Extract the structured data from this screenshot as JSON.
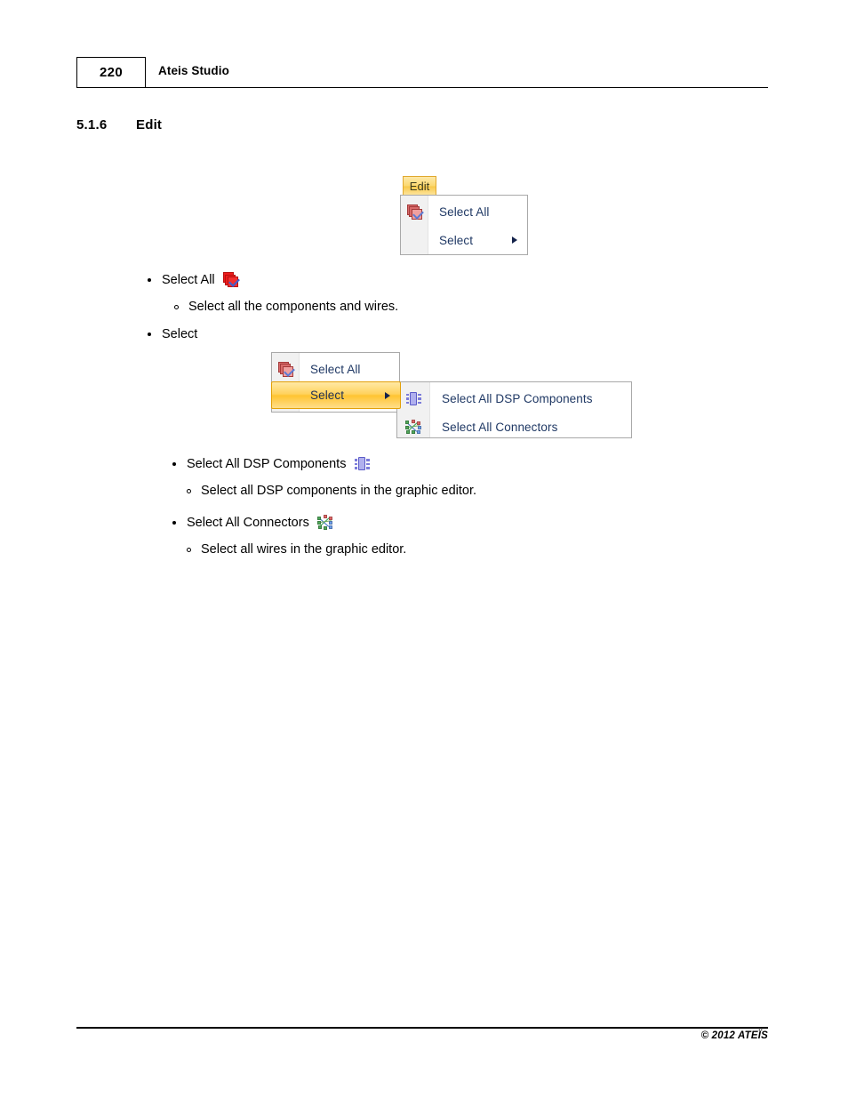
{
  "header": {
    "page_number": "220",
    "title": "Ateis Studio"
  },
  "section": {
    "number": "5.1.6",
    "title": "Edit"
  },
  "figure_edit_menu": {
    "tab_label": "Edit",
    "items": [
      {
        "label": "Select All",
        "icon": "select-all-icon",
        "has_submenu": false
      },
      {
        "label": "Select",
        "icon": "",
        "has_submenu": true
      }
    ]
  },
  "figure_select_menu": {
    "items": [
      {
        "label": "Select All",
        "icon": "select-all-icon",
        "has_submenu": false
      },
      {
        "label": "Select",
        "icon": "",
        "has_submenu": true,
        "highlighted": true
      }
    ],
    "submenu": {
      "items": [
        {
          "label": "Select All DSP Components",
          "icon": "dsp-components-icon"
        },
        {
          "label": "Select All Connectors",
          "icon": "connectors-icon"
        }
      ]
    }
  },
  "body": {
    "bullet_select_all": "Select All",
    "sub_select_all": "Select all the components and wires.",
    "bullet_select": "Select",
    "bullet_dsp": "Select All DSP Components",
    "sub_dsp": "Select all DSP components in the graphic editor.",
    "bullet_connectors": "Select All Connectors",
    "sub_connectors": "Select all wires in the graphic editor."
  },
  "footer": {
    "copyright": "© 2012 ATEÏS"
  },
  "colors": {
    "menu_text": "#1F3864",
    "highlight_gold": "#FFC431",
    "tab_gold": "#F8C84A",
    "icon_red": "#EE1C1C",
    "icon_purple": "#5B5BC8"
  }
}
